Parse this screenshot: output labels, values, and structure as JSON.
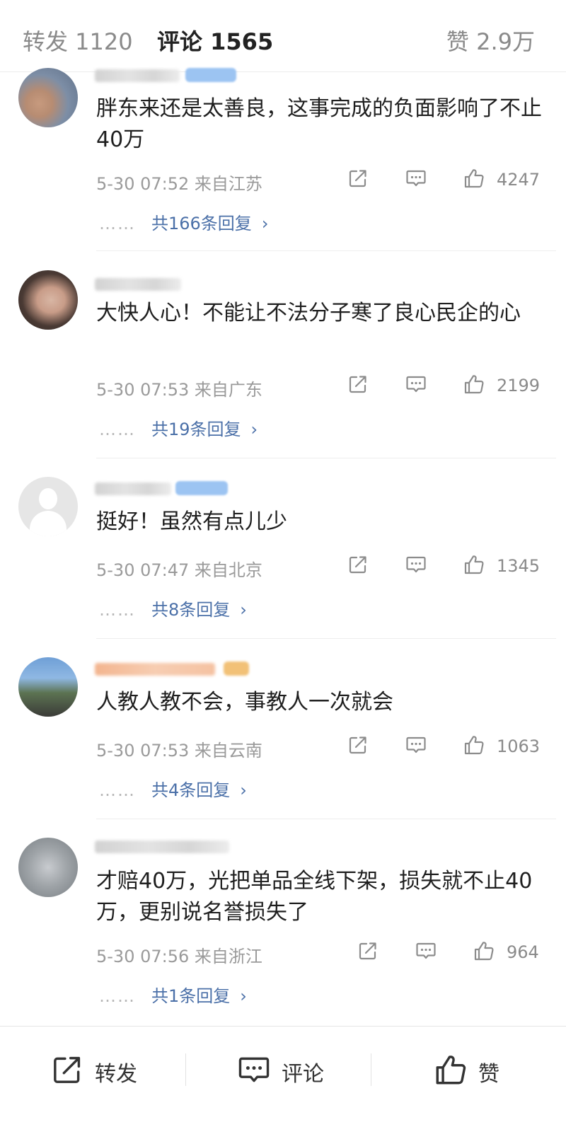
{
  "tabs": {
    "repost": "转发 1120",
    "comment": "评论 1565",
    "like": "赞 2.9万"
  },
  "comments": [
    {
      "text": "胖东来还是太善良，这事完成的负面影响了不止40万",
      "time": "5-30 07:52  来自江苏",
      "likes": "4247",
      "replies": "共166条回复"
    },
    {
      "text": "大快人心！不能让不法分子寒了良心民企的心",
      "time": "5-30 07:53  来自广东",
      "likes": "2199",
      "replies": "共19条回复"
    },
    {
      "text": "挺好！虽然有点儿少",
      "time": "5-30 07:47  来自北京",
      "likes": "1345",
      "replies": "共8条回复"
    },
    {
      "text": "人教人教不会，事教人一次就会",
      "time": "5-30 07:53  来自云南",
      "likes": "1063",
      "replies": "共4条回复"
    },
    {
      "text": "才赔40万，光把单品全线下架，损失就不止40万，更别说名誉损失了",
      "time": "5-30 07:56  来自浙江",
      "likes": "964",
      "replies": "共1条回复"
    }
  ],
  "bottom_bar": {
    "repost": "转发",
    "comment": "评论",
    "like": "赞"
  },
  "icons": {
    "share": "share-icon",
    "comment": "comment-icon",
    "like": "thumbs-up-icon",
    "reply_chevron": "chevron-right-icon"
  },
  "colors": {
    "reply_link": "#4b70a8",
    "meta_text": "#9a9a9a"
  }
}
